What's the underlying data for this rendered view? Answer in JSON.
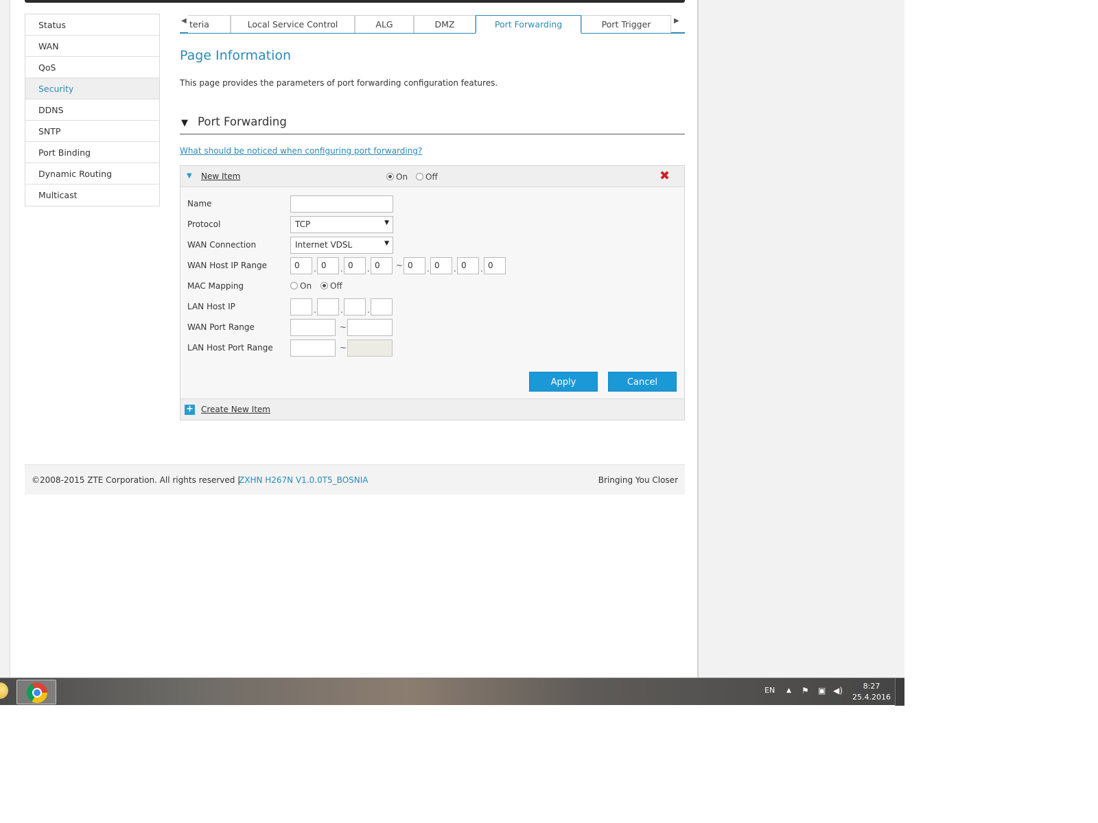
{
  "sidebar": {
    "items": [
      {
        "label": "Status"
      },
      {
        "label": "WAN"
      },
      {
        "label": "QoS"
      },
      {
        "label": "Security",
        "active": true
      },
      {
        "label": "DDNS"
      },
      {
        "label": "SNTP"
      },
      {
        "label": "Port Binding"
      },
      {
        "label": "Dynamic Routing"
      },
      {
        "label": "Multicast"
      }
    ]
  },
  "tabs": {
    "items": [
      {
        "label": "teria"
      },
      {
        "label": "Local Service Control"
      },
      {
        "label": "ALG"
      },
      {
        "label": "DMZ"
      },
      {
        "label": "Port Forwarding",
        "active": true
      },
      {
        "label": "Port Trigger"
      }
    ]
  },
  "page": {
    "title": "Page Information",
    "description": "This page provides the parameters of port forwarding configuration features."
  },
  "section": {
    "title": "Port Forwarding",
    "help_link": "What should be noticed when configuring port forwarding?"
  },
  "panel": {
    "item_label": "New Item",
    "on_label": "On",
    "off_label": "Off",
    "enabled": "On",
    "create_label": "Create New Item"
  },
  "form": {
    "name": {
      "label": "Name",
      "value": ""
    },
    "protocol": {
      "label": "Protocol",
      "value": "TCP"
    },
    "wan_connection": {
      "label": "WAN Connection",
      "value": "Internet VDSL"
    },
    "wan_host_ip_range": {
      "label": "WAN Host IP Range",
      "start": [
        "0",
        "0",
        "0",
        "0"
      ],
      "end": [
        "0",
        "0",
        "0",
        "0"
      ],
      "separator": "~"
    },
    "mac_mapping": {
      "label": "MAC Mapping",
      "on_label": "On",
      "off_label": "Off",
      "value": "Off"
    },
    "lan_host_ip": {
      "label": "LAN Host IP",
      "octets": [
        "",
        "",
        "",
        ""
      ]
    },
    "wan_port_range": {
      "label": "WAN Port Range",
      "start": "",
      "end": ""
    },
    "lan_host_port_range": {
      "label": "LAN Host Port Range",
      "start": "",
      "end": ""
    }
  },
  "buttons": {
    "apply": "Apply",
    "cancel": "Cancel"
  },
  "footer": {
    "copyright": "©2008-2015 ZTE Corporation. All rights reserved  |",
    "version": "ZXHN H267N V1.0.0T5_BOSNIA",
    "slogan": "Bringing You Closer"
  },
  "taskbar": {
    "language": "EN",
    "time": "8:27",
    "date": "25.4.2016"
  },
  "colors": {
    "accent": "#2a8ab5",
    "button": "#1b98d6",
    "close": "#cc2222"
  }
}
